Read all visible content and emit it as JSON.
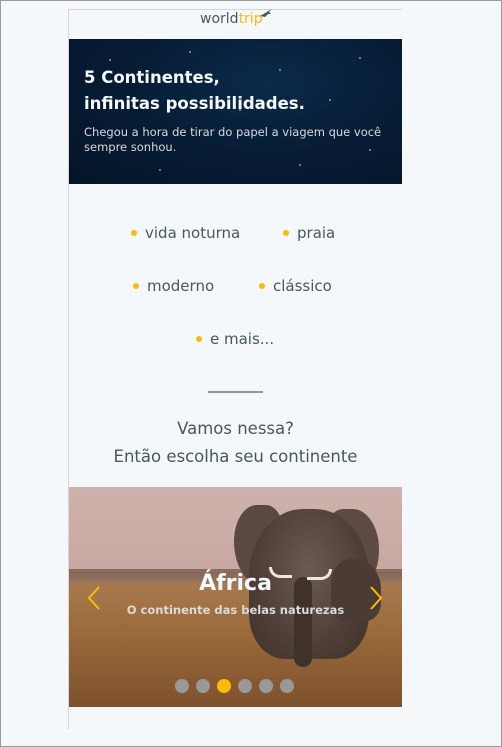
{
  "header": {
    "logo_part1": "world",
    "logo_part2": "trip"
  },
  "hero": {
    "title_line1": "5 Continentes,",
    "title_line2": "infinitas possibilidades.",
    "subtitle": "Chegou a hora de tirar do papel a viagem que você sempre sonhou."
  },
  "travel_types": [
    "vida noturna",
    "praia",
    "moderno",
    "clássico",
    "e mais..."
  ],
  "cta": {
    "line1": "Vamos nessa?",
    "line2": "Então escolha seu continente"
  },
  "slider": {
    "title": "África",
    "subtitle": "O continente das belas naturezas",
    "slide_count": 6,
    "active_index": 2
  },
  "colors": {
    "accent": "#ffba08",
    "text_dark": "#47585b",
    "light": "#f5f8fa",
    "hero_bg": "#061b33"
  },
  "icons": {
    "airplane": "airplane-icon",
    "prev": "chevron-left-icon",
    "next": "chevron-right-icon"
  }
}
